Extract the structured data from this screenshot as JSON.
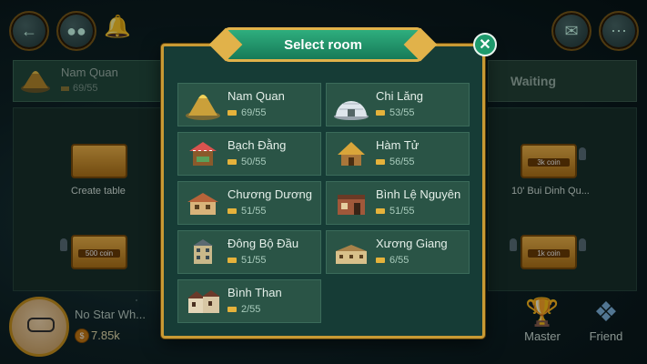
{
  "header": {
    "back_icon": "back-arrow-icon",
    "chat_icon": "chat-bubble-icon",
    "bell_icon": "bell-icon",
    "mail_icon": "mail-icon",
    "more_icon": "more-dots-icon"
  },
  "background": {
    "current_room": {
      "name": "Nam Quan",
      "count": "69/55"
    },
    "waiting_label": "Waiting",
    "create_table_label": "Create table",
    "table_tags": [
      "3k coin",
      "500 coin",
      "1k coin"
    ],
    "table_name": "10' Bui Dinh Qu..."
  },
  "player": {
    "name": "No Star Wh...",
    "coins": "7.85k"
  },
  "bottom_nav": [
    {
      "label": "Master",
      "icon": "trophy-icon"
    },
    {
      "label": "Friend",
      "icon": "friend-icon"
    }
  ],
  "modal": {
    "title": "Select room",
    "close_icon": "close-icon",
    "rooms": [
      {
        "name": "Nam Quan",
        "count": "69/55"
      },
      {
        "name": "Chi Lăng",
        "count": "53/55"
      },
      {
        "name": "Bạch Đằng",
        "count": "50/55"
      },
      {
        "name": "Hàm Tử",
        "count": "56/55"
      },
      {
        "name": "Chương Dương",
        "count": "51/55"
      },
      {
        "name": "Bình Lệ Nguyên",
        "count": "51/55"
      },
      {
        "name": "Đông Bộ Đầu",
        "count": "51/55"
      },
      {
        "name": "Xương Giang",
        "count": "6/55"
      },
      {
        "name": "Bình Than",
        "count": "2/55"
      }
    ]
  }
}
